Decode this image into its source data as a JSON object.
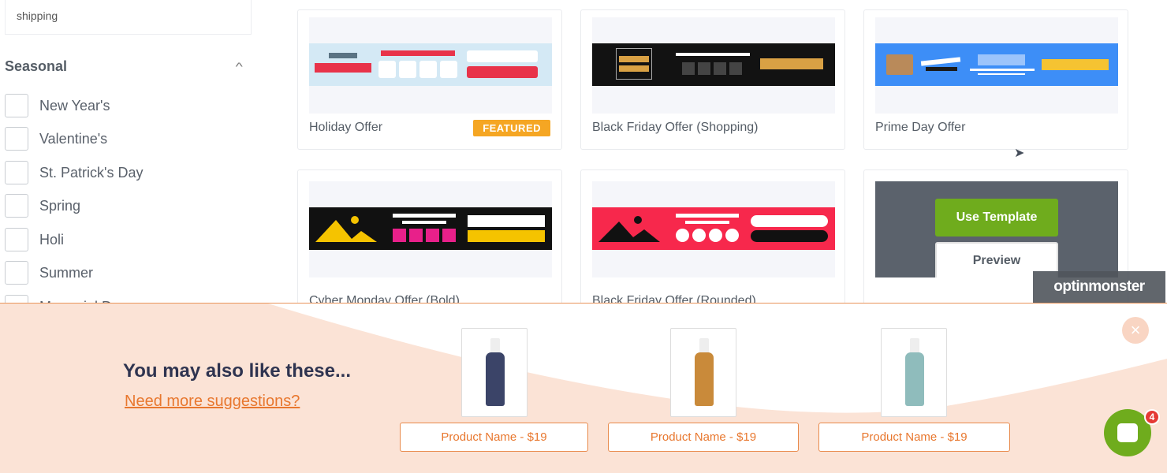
{
  "sidebar": {
    "search_value": "shipping",
    "section_title": "Seasonal",
    "items": [
      "New Year's",
      "Valentine's",
      "St. Patrick's Day",
      "Spring",
      "Holi",
      "Summer",
      "Memorial Day"
    ]
  },
  "templates": [
    {
      "name": "Holiday Offer",
      "badge": "FEATURED"
    },
    {
      "name": "Black Friday Offer (Shopping)"
    },
    {
      "name": "Prime Day Offer"
    },
    {
      "name": "Cyber Monday Offer (Bold)"
    },
    {
      "name": "Black Friday Offer (Rounded)"
    },
    {
      "name": "",
      "hover": {
        "use_label": "Use Template",
        "preview_label": "Preview"
      }
    }
  ],
  "branding": "optinmonster",
  "popup": {
    "title": "You may also like these...",
    "link": "Need more suggestions?",
    "products": [
      {
        "label": "Product Name - $19",
        "color": "#3b4468"
      },
      {
        "label": "Product Name - $19",
        "color": "#c98a3a"
      },
      {
        "label": "Product Name - $19",
        "color": "#8fbcbc"
      }
    ],
    "close_label": "×"
  },
  "chat": {
    "badge": "4"
  },
  "colors": {
    "accent_green": "#6fac1d",
    "popup_orange": "#e8772e",
    "featured": "#f5a623"
  }
}
